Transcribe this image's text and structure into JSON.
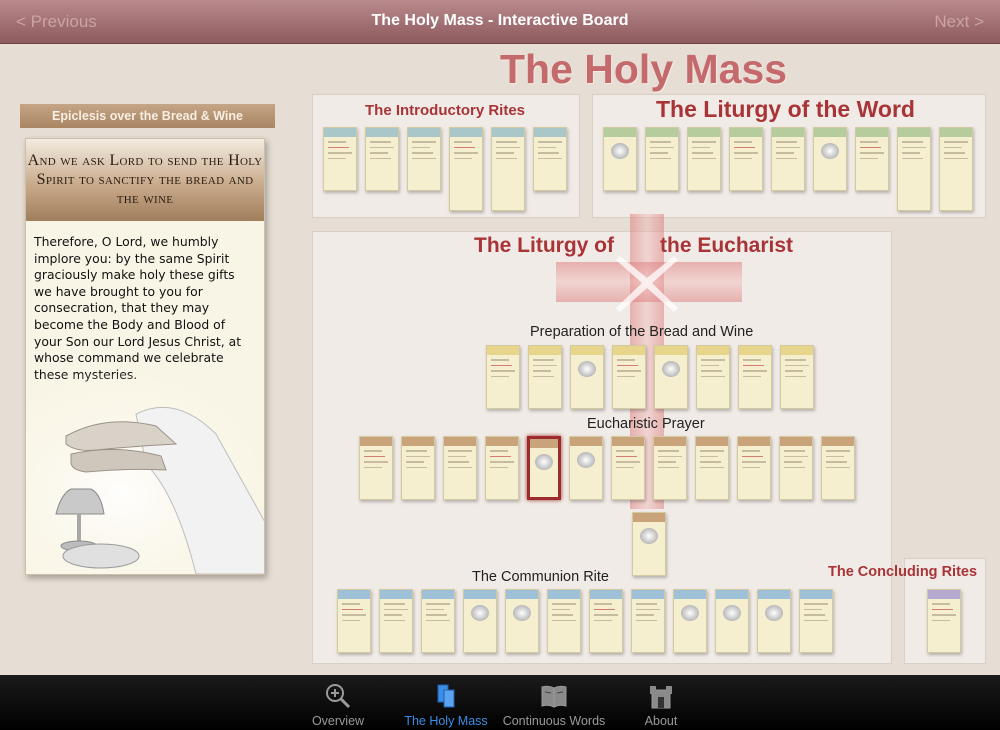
{
  "navbar": {
    "prev_label": "< Previous",
    "title": "The Holy Mass - Interactive Board",
    "next_label": "Next >"
  },
  "board": {
    "main_title": "The Holy Mass",
    "sections": {
      "introductory": "The Introductory Rites",
      "word": "The Liturgy of the Word",
      "eucharist_a": "The Liturgy of",
      "eucharist_b": "the Eucharist",
      "preparation": "Preparation of the Bread and Wine",
      "prayer": "Eucharistic Prayer",
      "communion": "The Communion Rite",
      "concluding": "The Concluding Rites"
    }
  },
  "info": {
    "breadcrumb": "Epiclesis over the Bread & Wine",
    "heading": "And we ask Lord to send the Holy Spirit to sanctify the bread and the wine",
    "body": "Therefore, O Lord, we humbly implore you: by the same Spirit graciously make holy these gifts we have brought to you for consecration, that they may become the Body and Blood of your Son our Lord Jesus Christ, at whose command we celebrate these mysteries."
  },
  "tabs": [
    {
      "label": "Overview",
      "icon": "zoom-in-icon",
      "active": false
    },
    {
      "label": "The Holy Mass",
      "icon": "board-icon",
      "active": true
    },
    {
      "label": "Continuous Words",
      "icon": "book-icon",
      "active": false
    },
    {
      "label": "About",
      "icon": "church-icon",
      "active": false
    }
  ],
  "colors": {
    "accent_red": "#a93437",
    "title_red": "#c56a6c",
    "tab_active": "#3a8ee6",
    "intro_header": "#a9c7c9",
    "word_header": "#b7cc9c",
    "prep_header": "#e6d58a",
    "prayer_header": "#c9a47a",
    "communion_header": "#9fc1d8",
    "concluding_header": "#b6a9cf"
  }
}
